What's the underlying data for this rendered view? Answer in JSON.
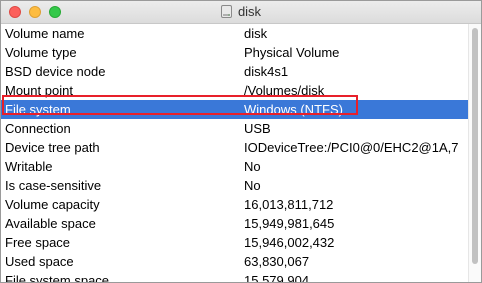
{
  "window": {
    "title": "disk",
    "title_icon": "disk-icon"
  },
  "rows": [
    {
      "label": "Volume name",
      "value": "disk"
    },
    {
      "label": "Volume type",
      "value": "Physical Volume"
    },
    {
      "label": "BSD device node",
      "value": "disk4s1"
    },
    {
      "label": "Mount point",
      "value": "/Volumes/disk"
    },
    {
      "label": "File system",
      "value": "Windows (NTFS)",
      "selected": true
    },
    {
      "label": "Connection",
      "value": "USB"
    },
    {
      "label": "Device tree path",
      "value": "IODeviceTree:/PCI0@0/EHC2@1A,7"
    },
    {
      "label": "Writable",
      "value": "No"
    },
    {
      "label": "Is case-sensitive",
      "value": "No"
    },
    {
      "label": "Volume capacity",
      "value": "16,013,811,712"
    },
    {
      "label": "Available space",
      "value": "15,949,981,645"
    },
    {
      "label": "Free space",
      "value": "15,946,002,432"
    },
    {
      "label": "Used space",
      "value": "63,830,067"
    },
    {
      "label": "File system space",
      "value": "15,579,904"
    }
  ],
  "colors": {
    "selection": "#3a78d8",
    "annotation": "#e8202a"
  }
}
